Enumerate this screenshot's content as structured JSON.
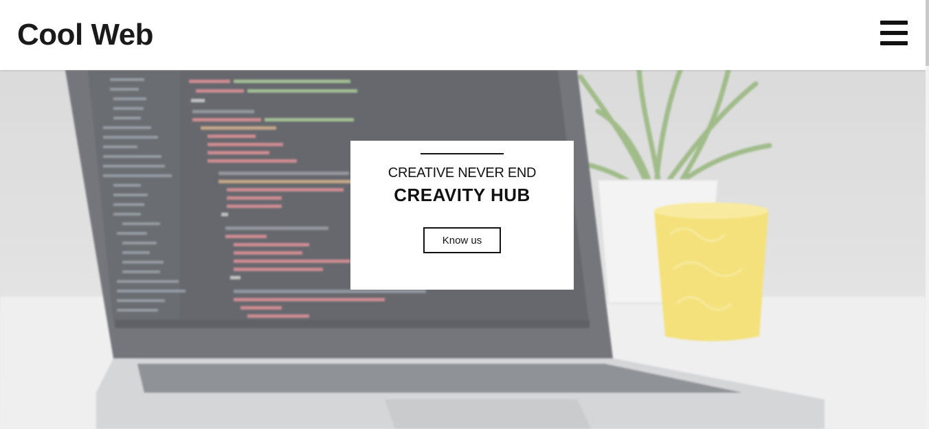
{
  "header": {
    "logo": "Cool Web",
    "menu_icon": "hamburger-menu-icon"
  },
  "hero": {
    "image": "laptop-with-code-editor-and-plant-image",
    "card": {
      "subtitle": "CREATIVE NEVER END",
      "title": "CREAVITY HUB",
      "button_label": "Know us"
    }
  },
  "colors": {
    "text": "#111111",
    "background": "#ffffff",
    "code_keyword": "#e06c75",
    "code_string": "#98c379",
    "mug": "#f2d640",
    "plant": "#5f8a3a"
  }
}
